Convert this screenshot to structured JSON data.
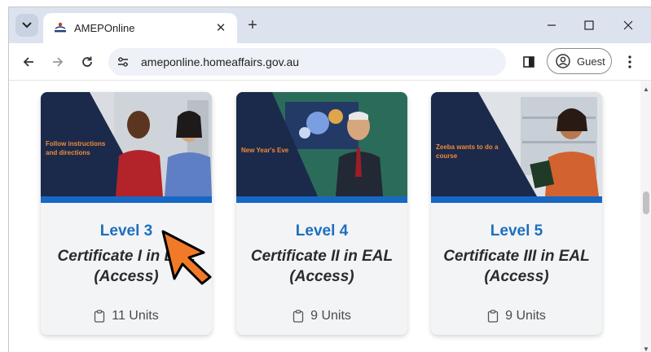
{
  "browser": {
    "tab": {
      "title": "AMEPOnline",
      "close_label": "✕"
    },
    "new_tab_label": "+",
    "url": "ameponline.homeaffairs.gov.au",
    "profile_label": "Guest"
  },
  "cards": [
    {
      "image_caption": "Follow instructions and directions",
      "level": "Level 3",
      "certificate": "Certificate I in EAL (Access)",
      "units": "11 Units"
    },
    {
      "image_caption": "New Year's Eve",
      "level": "Level 4",
      "certificate": "Certificate II in EAL (Access)",
      "units": "9 Units"
    },
    {
      "image_caption": "Zeeba wants to do a course",
      "level": "Level 5",
      "certificate": "Certificate III in EAL (Access)",
      "units": "9 Units"
    }
  ],
  "colors": {
    "level_blue": "#1c6fbf",
    "card_bar_blue": "#1768c4",
    "navy_panel": "#1b2a4a",
    "caption_orange": "#f08a3c",
    "cursor_orange": "#f07a28"
  },
  "icons": [
    "chevron-down-icon",
    "amep-favicon",
    "close-icon",
    "plus-icon",
    "minimize-icon",
    "maximize-icon",
    "back-arrow-icon",
    "forward-arrow-icon",
    "reload-icon",
    "site-info-icon",
    "side-panel-icon",
    "profile-icon",
    "kebab-menu-icon",
    "clipboard-icon",
    "pointer-cursor-icon"
  ]
}
